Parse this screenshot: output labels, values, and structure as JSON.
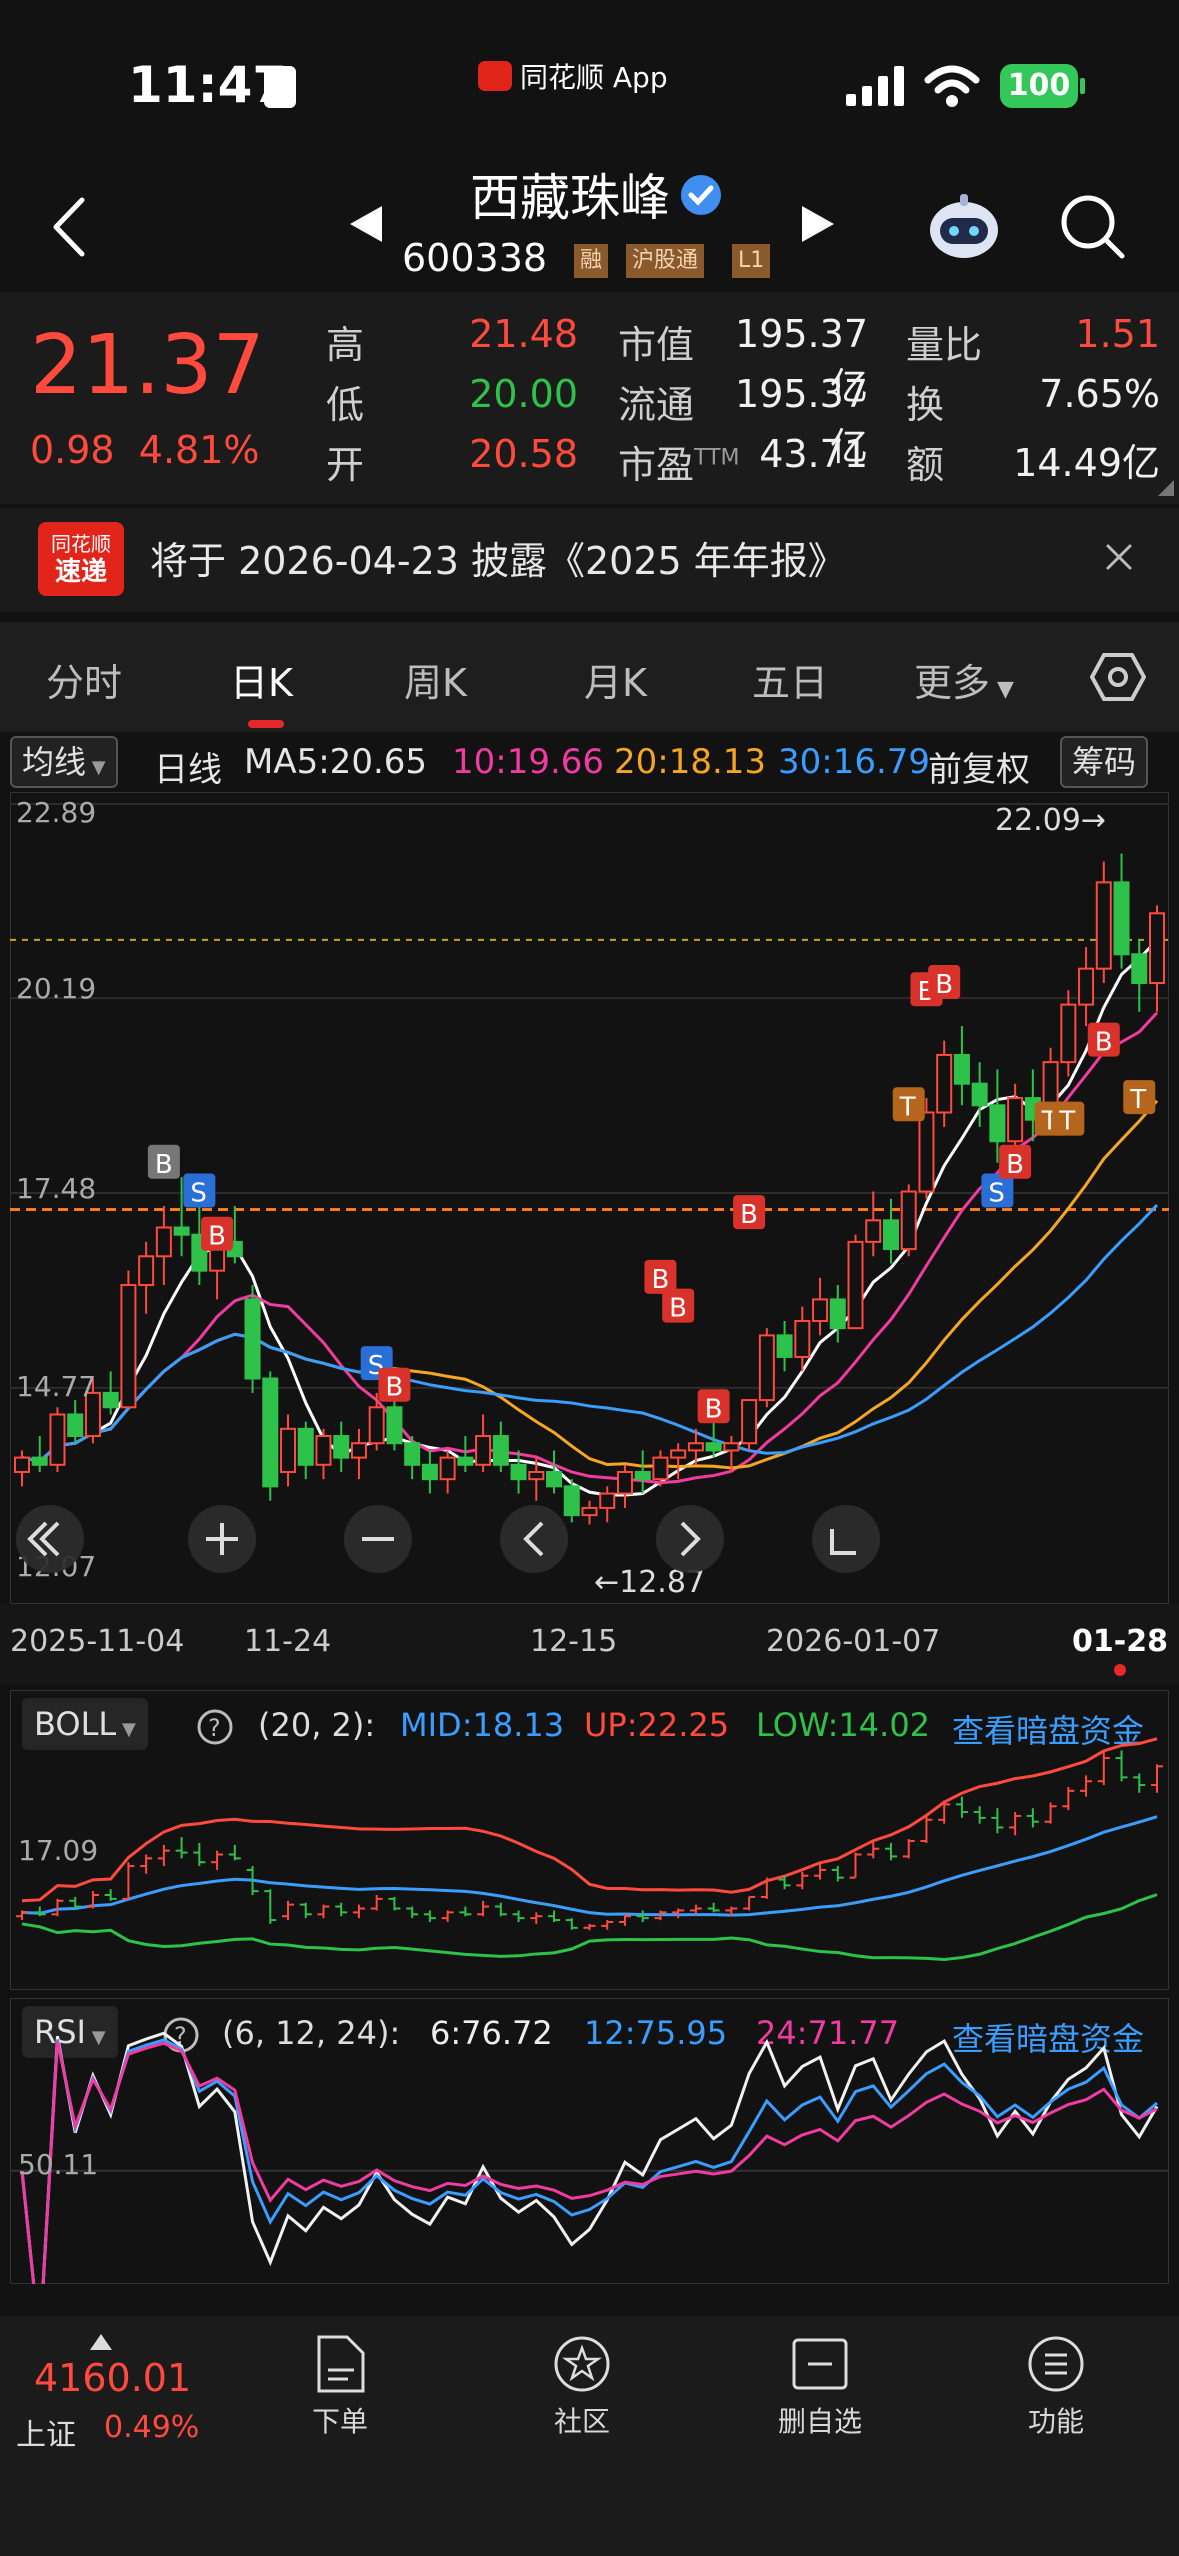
{
  "status": {
    "time": "11:47",
    "app": "同花顺 App",
    "battery": "100"
  },
  "header": {
    "name": "西藏珠峰",
    "code": "600338",
    "tags": [
      "融",
      "沪股通",
      "L1"
    ]
  },
  "quote": {
    "price": "21.37",
    "change": "0.98",
    "change_pct": "4.81%",
    "high_label": "高",
    "high": "21.48",
    "low_label": "低",
    "low": "20.00",
    "open_label": "开",
    "open": "20.58",
    "mcap_label": "市值",
    "mcap": "195.37亿",
    "float_label": "流通",
    "float": "195.37亿",
    "pe_label": "市盈",
    "pe_sup": "TTM",
    "pe": "43.71",
    "vr_label": "量比",
    "vr": "1.51",
    "turn_label": "换",
    "turn": "7.65%",
    "amt_label": "额",
    "amt": "14.49亿"
  },
  "notice": {
    "logo_line1": "同花顺",
    "logo_line2": "速递",
    "text": "将于 2026-04-23 披露《2025 年年报》"
  },
  "tabs": [
    "分时",
    "日K",
    "周K",
    "月K",
    "五日",
    "更多"
  ],
  "ma_row": {
    "type": "均线",
    "period": "日线",
    "ma5": "MA5:20.65",
    "ma10": "10:19.66",
    "ma20": "20:18.13",
    "ma30": "30:16.79",
    "adjust": "前复权",
    "chips": "筹码"
  },
  "main_chart": {
    "y_labels": [
      "22.89",
      "20.19",
      "17.48",
      "14.77",
      "12.07"
    ],
    "max_label": "22.09→",
    "min_label": "←12.87"
  },
  "dates": [
    "2025-11-04",
    "11-24",
    "12-15",
    "2026-01-07",
    "01-28"
  ],
  "boll": {
    "name": "BOLL",
    "params": "(20, 2):",
    "mid": "MID:18.13",
    "up": "UP:22.25",
    "low": "LOW:14.02",
    "link": "查看暗盘资金",
    "y_label": "17.09"
  },
  "rsi": {
    "name": "RSI",
    "params": "(6, 12, 24):",
    "r6": "6:76.72",
    "r12": "12:75.95",
    "r24": "24:71.77",
    "link": "查看暗盘资金",
    "y_label": "50.11"
  },
  "bottom": {
    "index_value": "4160.01",
    "index_name": "上证",
    "index_pct": "0.49%",
    "items": [
      "下单",
      "社区",
      "删自选",
      "功能"
    ]
  },
  "chart_data": {
    "type": "candlestick",
    "y_range": [
      12.07,
      22.89
    ],
    "candles": [
      [
        13.6,
        13.9,
        13.4,
        13.8
      ],
      [
        13.8,
        14.1,
        13.6,
        13.7
      ],
      [
        13.7,
        14.5,
        13.6,
        14.4
      ],
      [
        14.4,
        14.6,
        14.0,
        14.1
      ],
      [
        14.1,
        14.9,
        14.0,
        14.7
      ],
      [
        14.7,
        15.0,
        14.4,
        14.5
      ],
      [
        14.5,
        16.4,
        14.5,
        16.2
      ],
      [
        16.2,
        16.8,
        15.8,
        16.6
      ],
      [
        16.6,
        17.3,
        16.2,
        17.0
      ],
      [
        17.0,
        17.7,
        16.6,
        16.9
      ],
      [
        16.9,
        17.4,
        16.2,
        16.4
      ],
      [
        16.4,
        17.0,
        16.0,
        16.8
      ],
      [
        16.8,
        17.3,
        16.5,
        16.6
      ],
      [
        16.0,
        16.2,
        14.7,
        14.9
      ],
      [
        14.9,
        15.0,
        13.2,
        13.4
      ],
      [
        13.6,
        14.4,
        13.4,
        14.2
      ],
      [
        14.2,
        14.3,
        13.5,
        13.7
      ],
      [
        13.7,
        14.2,
        13.5,
        14.1
      ],
      [
        14.1,
        14.3,
        13.6,
        13.8
      ],
      [
        13.8,
        14.2,
        13.5,
        14.0
      ],
      [
        14.0,
        14.7,
        13.9,
        14.5
      ],
      [
        14.5,
        14.6,
        13.9,
        14.0
      ],
      [
        14.0,
        14.1,
        13.5,
        13.7
      ],
      [
        13.7,
        13.9,
        13.3,
        13.5
      ],
      [
        13.5,
        13.9,
        13.3,
        13.8
      ],
      [
        13.8,
        14.1,
        13.6,
        13.7
      ],
      [
        13.7,
        14.4,
        13.6,
        14.1
      ],
      [
        14.1,
        14.3,
        13.6,
        13.7
      ],
      [
        13.7,
        13.9,
        13.3,
        13.5
      ],
      [
        13.5,
        13.8,
        13.2,
        13.6
      ],
      [
        13.6,
        13.9,
        13.3,
        13.4
      ],
      [
        13.4,
        13.5,
        12.9,
        13.0
      ],
      [
        13.0,
        13.2,
        12.87,
        13.1
      ],
      [
        13.1,
        13.4,
        12.9,
        13.3
      ],
      [
        13.3,
        13.7,
        13.1,
        13.6
      ],
      [
        13.6,
        13.9,
        13.3,
        13.5
      ],
      [
        13.5,
        13.9,
        13.4,
        13.8
      ],
      [
        13.8,
        14.0,
        13.5,
        13.9
      ],
      [
        13.9,
        14.2,
        13.7,
        14.0
      ],
      [
        14.0,
        14.3,
        13.8,
        13.9
      ],
      [
        13.9,
        14.1,
        13.6,
        14.0
      ],
      [
        14.0,
        14.6,
        13.9,
        14.6
      ],
      [
        14.6,
        15.6,
        14.5,
        15.5
      ],
      [
        15.5,
        15.7,
        15.0,
        15.2
      ],
      [
        15.2,
        15.9,
        15.0,
        15.7
      ],
      [
        15.7,
        16.3,
        15.5,
        16.0
      ],
      [
        16.0,
        16.2,
        15.4,
        15.6
      ],
      [
        15.6,
        16.9,
        15.6,
        16.8
      ],
      [
        16.8,
        17.5,
        16.6,
        17.1
      ],
      [
        17.1,
        17.4,
        16.5,
        16.7
      ],
      [
        16.7,
        17.6,
        16.6,
        17.5
      ],
      [
        17.5,
        18.8,
        17.4,
        18.6
      ],
      [
        18.6,
        19.6,
        18.4,
        19.4
      ],
      [
        19.4,
        19.8,
        18.7,
        19.0
      ],
      [
        19.0,
        19.3,
        18.4,
        18.7
      ],
      [
        18.7,
        19.2,
        17.9,
        18.2
      ],
      [
        18.2,
        19.0,
        17.8,
        18.8
      ],
      [
        18.8,
        19.2,
        18.2,
        18.5
      ],
      [
        18.5,
        19.5,
        18.4,
        19.3
      ],
      [
        19.3,
        20.3,
        19.1,
        20.1
      ],
      [
        20.1,
        20.9,
        19.8,
        20.6
      ],
      [
        20.6,
        22.09,
        20.4,
        21.8
      ],
      [
        21.8,
        22.2,
        20.6,
        20.8
      ],
      [
        20.8,
        21.0,
        20.0,
        20.4
      ],
      [
        20.4,
        21.48,
        20.0,
        21.37
      ]
    ]
  }
}
